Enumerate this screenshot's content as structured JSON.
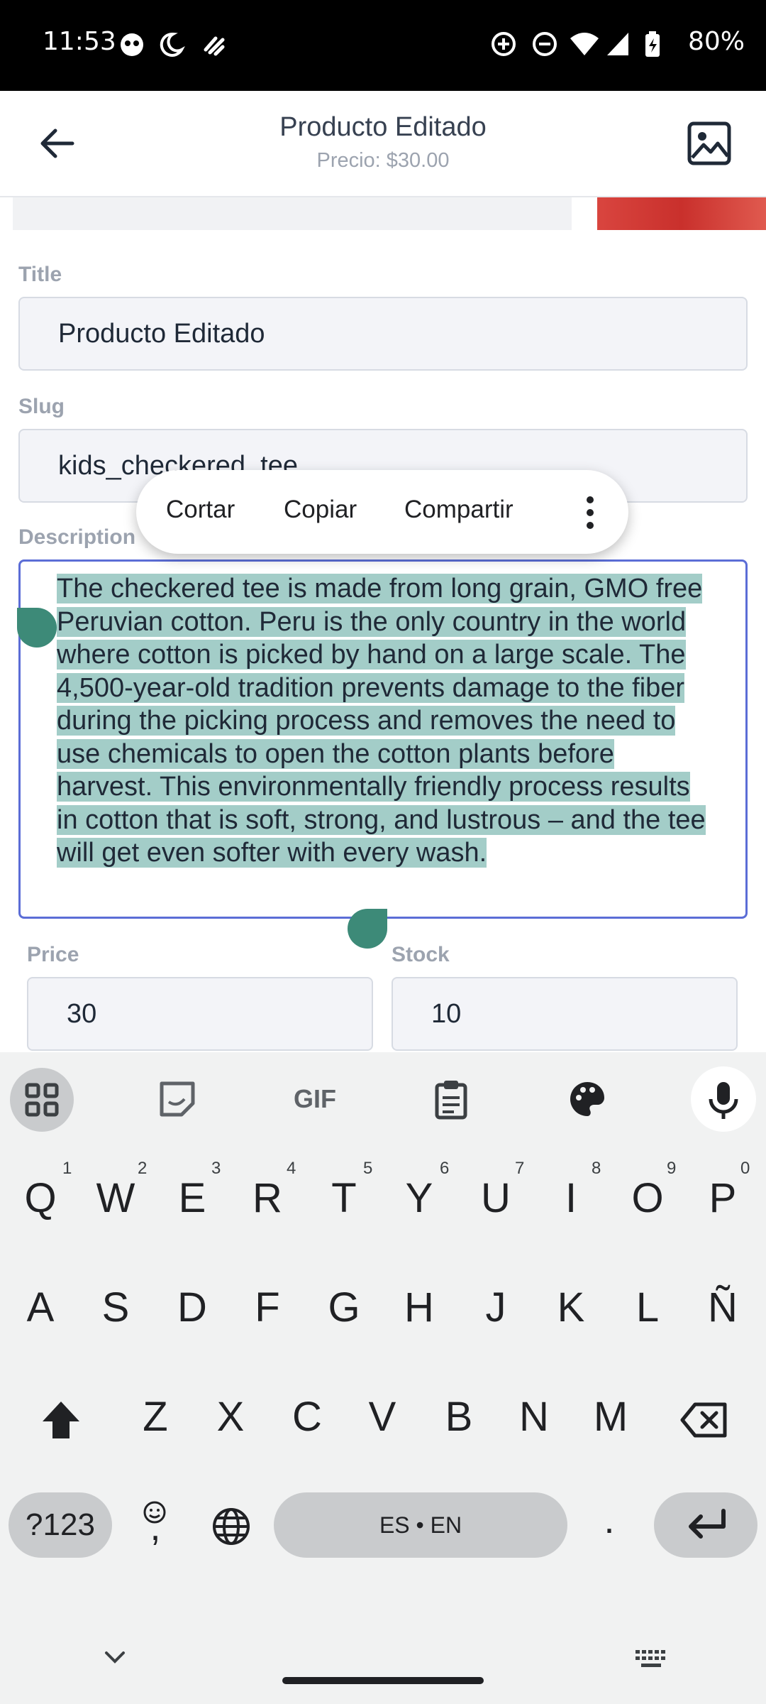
{
  "status_bar": {
    "time": "11:53",
    "battery": "80%"
  },
  "header": {
    "title": "Producto Editado",
    "subtitle": "Precio: $30.00"
  },
  "form": {
    "title_label": "Title",
    "title_value": "Producto Editado",
    "slug_label": "Slug",
    "slug_value": "kids_checkered_tee",
    "description_label": "Description",
    "description_selected": "The checkered tee is made from long grain, GMO free Peruvian cotton. Peru is the only country in the world where cotton is picked by hand on a large scale. The 4,500-year-old tradition prevents damage to the fiber during the picking process and removes the need to use chemicals to open the cotton plants before harvest. This environmentally friendly process results in cotton that is soft, strong, and lustrous – and the tee will get even softer with every wash.",
    "price_label": "Price",
    "price_value": "30",
    "stock_label": "Stock",
    "stock_value": "10"
  },
  "selection_toolbar": {
    "cut": "Cortar",
    "copy": "Copiar",
    "share": "Compartir"
  },
  "keyboard": {
    "row1": [
      "Q",
      "W",
      "E",
      "R",
      "T",
      "Y",
      "U",
      "I",
      "O",
      "P"
    ],
    "row1_hints": [
      "1",
      "2",
      "3",
      "4",
      "5",
      "6",
      "7",
      "8",
      "9",
      "0"
    ],
    "row2": [
      "A",
      "S",
      "D",
      "F",
      "G",
      "H",
      "J",
      "K",
      "L",
      "Ñ"
    ],
    "row3": [
      "Z",
      "X",
      "C",
      "V",
      "B",
      "N",
      "M"
    ],
    "symbols_key": "?123",
    "comma_key": ",",
    "space_label": "ES • EN",
    "period_key": ".",
    "gif_label": "GIF"
  },
  "colors": {
    "selection": "#a3cdc8",
    "handle": "#3d8a78",
    "focus_border": "#5b6dd6"
  },
  "icons": [
    "back-arrow-icon",
    "image-icon",
    "grid-apps-icon",
    "sticker-icon",
    "clipboard-icon",
    "palette-icon",
    "mic-icon",
    "shift-icon",
    "backspace-icon",
    "emoji-icon",
    "globe-icon",
    "enter-icon",
    "chevron-down-icon",
    "keyboard-icon"
  ]
}
